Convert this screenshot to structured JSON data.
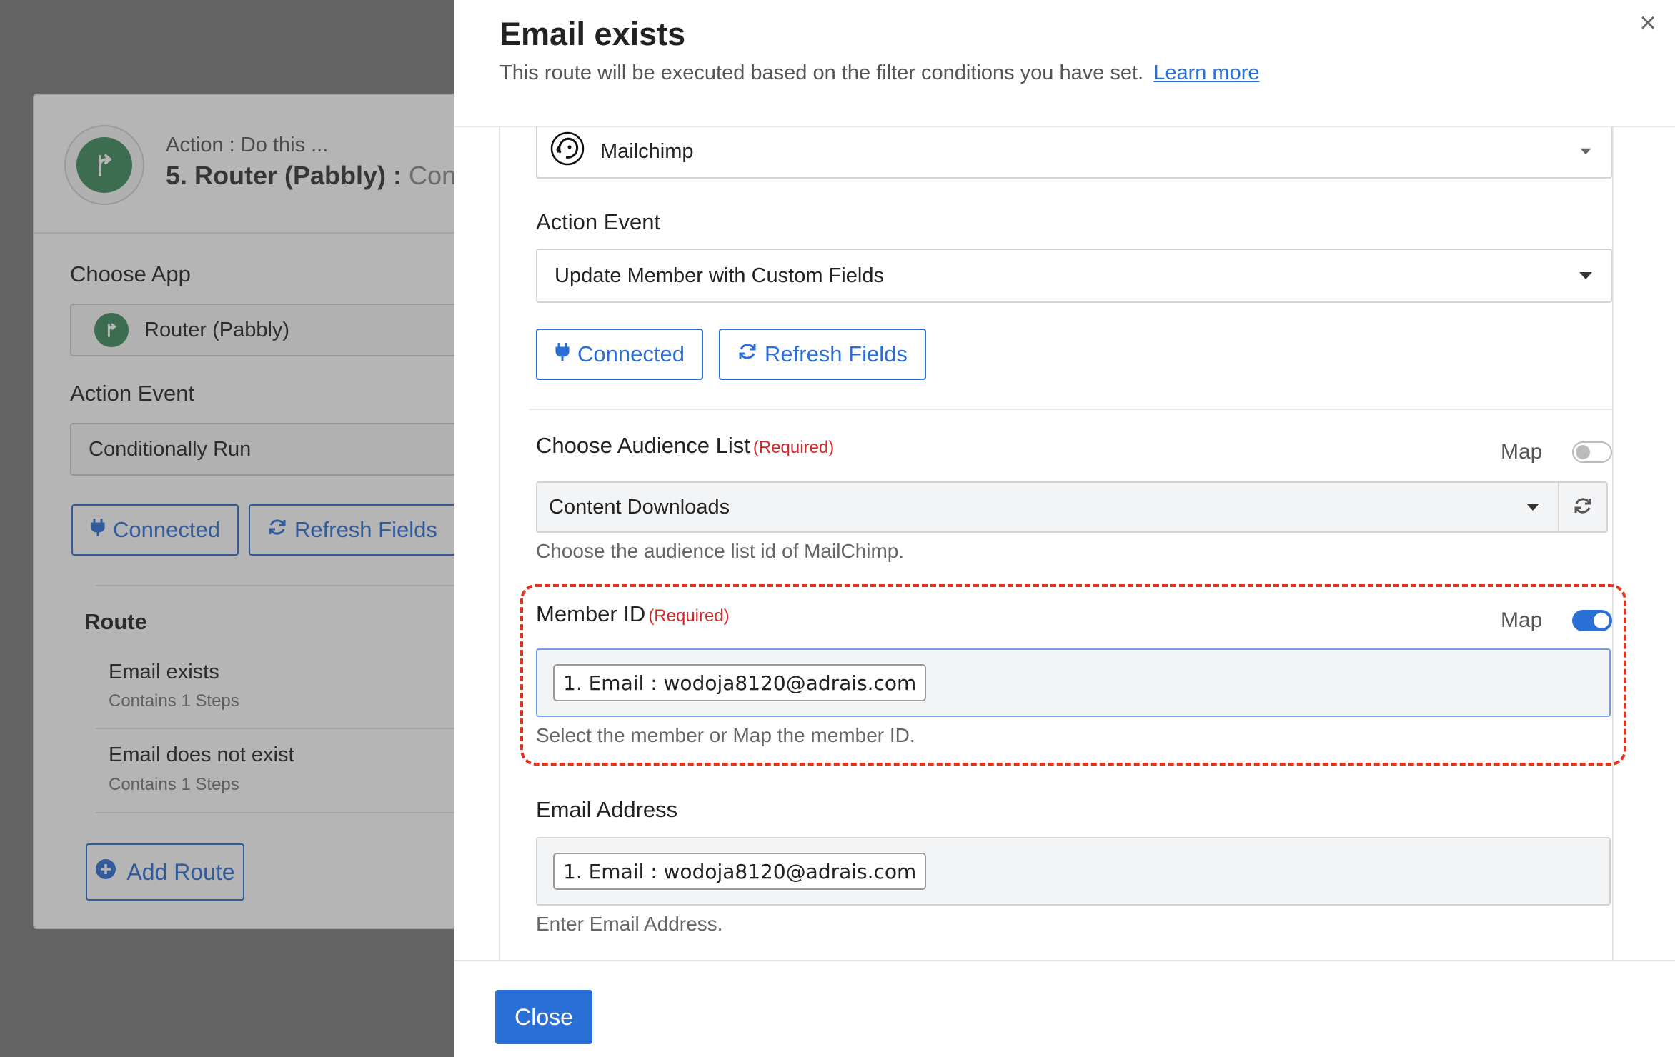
{
  "background": {
    "action_sub": "Action : Do this ...",
    "action_title": "5. Router (Pabbly) :",
    "action_title_suffix": "Cond",
    "choose_app_label": "Choose App",
    "app_value": "Router (Pabbly)",
    "action_event_label": "Action Event",
    "action_event_value": "Conditionally Run",
    "connected_label": "Connected",
    "refresh_label": "Refresh Fields",
    "route_title": "Route",
    "routes": [
      {
        "name": "Email exists",
        "steps": "Contains 1 Steps"
      },
      {
        "name": "Email does not exist",
        "steps": "Contains 1 Steps"
      }
    ],
    "add_route_label": "Add Route"
  },
  "modal": {
    "title": "Email exists",
    "subtitle": "This route will be executed based on the filter conditions you have set.",
    "learn_more": "Learn more",
    "close_icon": "×",
    "app_name": "Mailchimp",
    "action_event_label": "Action Event",
    "action_event_value": "Update Member with Custom Fields",
    "connected_label": "Connected",
    "refresh_label": "Refresh Fields",
    "audience": {
      "label": "Choose Audience List",
      "required": "(Required)",
      "map_label": "Map",
      "map_on": false,
      "value": "Content Downloads",
      "help": "Choose the audience list id of MailChimp."
    },
    "member_id": {
      "label": "Member ID",
      "required": "(Required)",
      "map_label": "Map",
      "map_on": true,
      "chip": "1. Email : wodoja8120@adrais.com",
      "help": "Select the member or Map the member ID."
    },
    "email_address": {
      "label": "Email Address",
      "chip": "1. Email : wodoja8120@adrais.com",
      "help": "Enter Email Address."
    },
    "close_button": "Close"
  },
  "colors": {
    "accent": "#2a6fd6",
    "required": "#d12a2a",
    "highlight": "#e2341d",
    "router_green": "#3d8c5c"
  }
}
